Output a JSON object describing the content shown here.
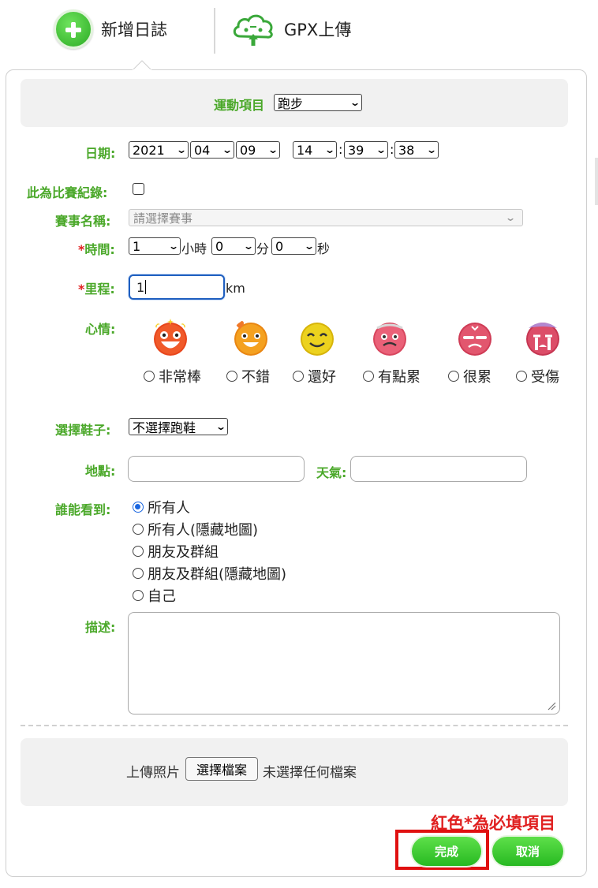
{
  "tabs": {
    "new_log": "新增日誌",
    "gpx_upload": "GPX上傳"
  },
  "sport": {
    "label": "運動項目",
    "value": "跑步"
  },
  "date": {
    "label": "日期:",
    "year": "2021",
    "month": "04",
    "day": "09",
    "hour": "14",
    "minute": "39",
    "second": "38",
    "colon": ":"
  },
  "race_record": {
    "label": "此為比賽紀錄:",
    "checked": false
  },
  "race_name": {
    "label": "賽事名稱:",
    "placeholder": "請選擇賽事"
  },
  "duration": {
    "required_mark": "*",
    "label": "時間:",
    "hours": "1",
    "hours_unit": "小時",
    "minutes": "0",
    "minutes_unit": "分",
    "seconds": "0",
    "seconds_unit": "秒"
  },
  "distance": {
    "required_mark": "*",
    "label": "里程:",
    "value": "1",
    "unit": "km"
  },
  "mood": {
    "label": "心情:",
    "options": [
      {
        "label": "非常棒",
        "icon": "excited-face-icon",
        "color": "#e8461c"
      },
      {
        "label": "不錯",
        "icon": "happy-face-icon",
        "color": "#f08a12"
      },
      {
        "label": "還好",
        "icon": "smile-face-icon",
        "color": "#e3c20c"
      },
      {
        "label": "有點累",
        "icon": "tired-face-icon",
        "color": "#e0506a"
      },
      {
        "label": "很累",
        "icon": "exhausted-face-icon",
        "color": "#d9425c"
      },
      {
        "label": "受傷",
        "icon": "crying-face-icon",
        "color": "#c93a58"
      }
    ]
  },
  "shoes": {
    "label": "選擇鞋子:",
    "value": "不選擇跑鞋"
  },
  "location": {
    "label": "地點:",
    "value": ""
  },
  "weather": {
    "label": "天氣:",
    "value": ""
  },
  "visibility": {
    "label": "誰能看到:",
    "options": [
      "所有人",
      "所有人(隱藏地圖)",
      "朋友及群組",
      "朋友及群組(隱藏地圖)",
      "自己"
    ],
    "selected_index": 0
  },
  "description": {
    "label": "描述:",
    "value": ""
  },
  "upload": {
    "label": "上傳照片",
    "button": "選擇檔案",
    "status": "未選擇任何檔案"
  },
  "footer": {
    "required_note": "紅色*為必填項目",
    "done": "完成",
    "cancel": "取消"
  },
  "colors": {
    "accent_green": "#4aa829",
    "button_green": "#27b921",
    "required_red": "#e02020",
    "focus_blue": "#1f5fc0"
  }
}
